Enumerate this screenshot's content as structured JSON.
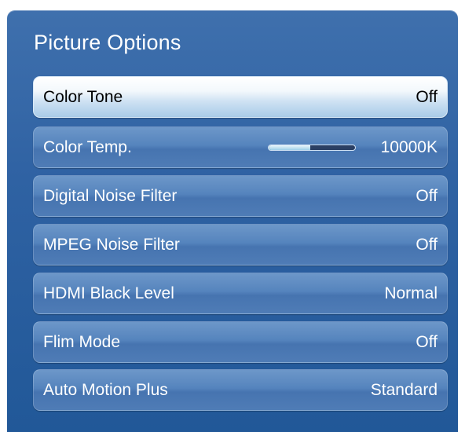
{
  "menu": {
    "title": "Picture Options",
    "items": [
      {
        "label": "Color Tone",
        "value": "Off",
        "selected": true
      },
      {
        "label": "Color Temp.",
        "value": "10000K",
        "slider_level": 0.48
      },
      {
        "label": "Digital Noise Filter",
        "value": "Off"
      },
      {
        "label": "MPEG Noise Filter",
        "value": "Off"
      },
      {
        "label": "HDMI Black Level",
        "value": "Normal"
      },
      {
        "label": "Flim Mode",
        "value": "Off"
      },
      {
        "label": "Auto Motion Plus",
        "value": "Standard"
      }
    ]
  },
  "colors": {
    "panel": "#2f62a3",
    "row": "#5584bd",
    "selected_row": "#cfe2f3"
  }
}
